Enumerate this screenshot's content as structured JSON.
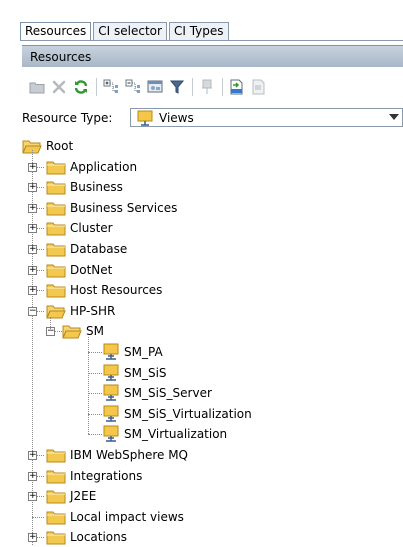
{
  "tabs": [
    "Resources",
    "CI selector",
    "CI Types"
  ],
  "panel": {
    "title": "Resources"
  },
  "toolbar": {
    "buttons": [
      {
        "name": "new-folder-icon",
        "enabled": false
      },
      {
        "name": "delete-icon",
        "enabled": false
      },
      {
        "name": "refresh-icon",
        "enabled": true
      },
      {
        "name": "expand-all-icon",
        "enabled": true
      },
      {
        "name": "collapse-all-icon",
        "enabled": true
      },
      {
        "name": "show-view-icon",
        "enabled": true
      },
      {
        "name": "filter-icon",
        "enabled": true
      },
      {
        "name": "pin-icon",
        "enabled": false
      },
      {
        "name": "export-xml-icon",
        "enabled": true
      },
      {
        "name": "import-icon",
        "enabled": false
      }
    ]
  },
  "resource_type": {
    "label": "Resource Type:",
    "value": "Views"
  },
  "tree": {
    "root": "Root",
    "items": [
      {
        "label": "Application",
        "type": "folder",
        "level": 1,
        "expanded": false
      },
      {
        "label": "Business",
        "type": "folder",
        "level": 1,
        "expanded": false
      },
      {
        "label": "Business Services",
        "type": "folder",
        "level": 1,
        "expanded": false
      },
      {
        "label": "Cluster",
        "type": "folder",
        "level": 1,
        "expanded": false
      },
      {
        "label": "Database",
        "type": "folder",
        "level": 1,
        "expanded": false
      },
      {
        "label": "DotNet",
        "type": "folder",
        "level": 1,
        "expanded": false
      },
      {
        "label": "Host Resources",
        "type": "folder",
        "level": 1,
        "expanded": false
      },
      {
        "label": "HP-SHR",
        "type": "folder",
        "level": 1,
        "expanded": true
      },
      {
        "label": "SM",
        "type": "folder",
        "level": 2,
        "expanded": true
      },
      {
        "label": "SM_PA",
        "type": "view",
        "level": 3
      },
      {
        "label": "SM_SiS",
        "type": "view",
        "level": 3
      },
      {
        "label": "SM_SiS_Server",
        "type": "view",
        "level": 3
      },
      {
        "label": "SM_SiS_Virtualization",
        "type": "view",
        "level": 3
      },
      {
        "label": "SM_Virtualization",
        "type": "view",
        "level": 3
      },
      {
        "label": "IBM WebSphere MQ",
        "type": "folder",
        "level": 1,
        "expanded": false
      },
      {
        "label": "Integrations",
        "type": "folder",
        "level": 1,
        "expanded": false
      },
      {
        "label": "J2EE",
        "type": "folder",
        "level": 1,
        "expanded": false
      },
      {
        "label": "Local impact views",
        "type": "folder",
        "level": 1,
        "leaf": true
      },
      {
        "label": "Locations",
        "type": "folder",
        "level": 1,
        "expanded": false
      }
    ]
  }
}
